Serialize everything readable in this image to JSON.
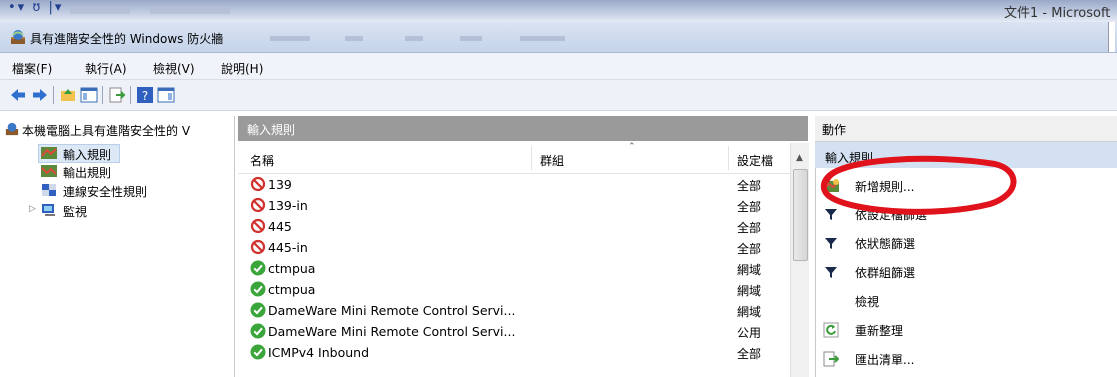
{
  "top_strip": {
    "doc_title": "文件1 - Microsoft"
  },
  "window": {
    "title": "具有進階安全性的 Windows 防火牆"
  },
  "menu": [
    "檔案(F)",
    "執行(A)",
    "檢視(V)",
    "說明(H)"
  ],
  "tree": {
    "root": "本機電腦上具有進階安全性的 V",
    "items": [
      {
        "label": "輸入規則",
        "selected": true
      },
      {
        "label": "輸出規則",
        "selected": false
      },
      {
        "label": "連線安全性規則",
        "selected": false
      },
      {
        "label": "監視",
        "selected": false
      }
    ]
  },
  "list": {
    "title": "輸入規則",
    "columns": {
      "name": "名稱",
      "group": "群組",
      "profile": "設定檔"
    },
    "rows": [
      {
        "name": "139",
        "profile": "全部",
        "status": "blocked"
      },
      {
        "name": "139-in",
        "profile": "全部",
        "status": "blocked"
      },
      {
        "name": "445",
        "profile": "全部",
        "status": "blocked"
      },
      {
        "name": "445-in",
        "profile": "全部",
        "status": "blocked"
      },
      {
        "name": "ctmpua",
        "profile": "網域",
        "status": "allowed"
      },
      {
        "name": "ctmpua",
        "profile": "網域",
        "status": "allowed"
      },
      {
        "name": "DameWare Mini Remote Control Servi...",
        "profile": "網域",
        "status": "allowed"
      },
      {
        "name": "DameWare Mini Remote Control Servi...",
        "profile": "公用",
        "status": "allowed"
      },
      {
        "name": "ICMPv4 Inbound",
        "profile": "全部",
        "status": "allowed"
      }
    ]
  },
  "actions": {
    "title": "動作",
    "section": "輸入規則",
    "items": [
      {
        "label": "新增規則...",
        "icon": "new-rule-icon"
      },
      {
        "label": "依設定檔篩選",
        "icon": "filter-icon"
      },
      {
        "label": "依狀態篩選",
        "icon": "filter-icon"
      },
      {
        "label": "依群組篩選",
        "icon": "filter-icon"
      },
      {
        "label": "檢視",
        "icon": "none"
      },
      {
        "label": "重新整理",
        "icon": "refresh-icon"
      },
      {
        "label": "匯出清單...",
        "icon": "export-icon"
      }
    ]
  },
  "colors": {
    "annotation": "#e0121b",
    "allowed": "#3aa53a",
    "blocked": "#d0312d",
    "selection": "#dde8f6"
  }
}
